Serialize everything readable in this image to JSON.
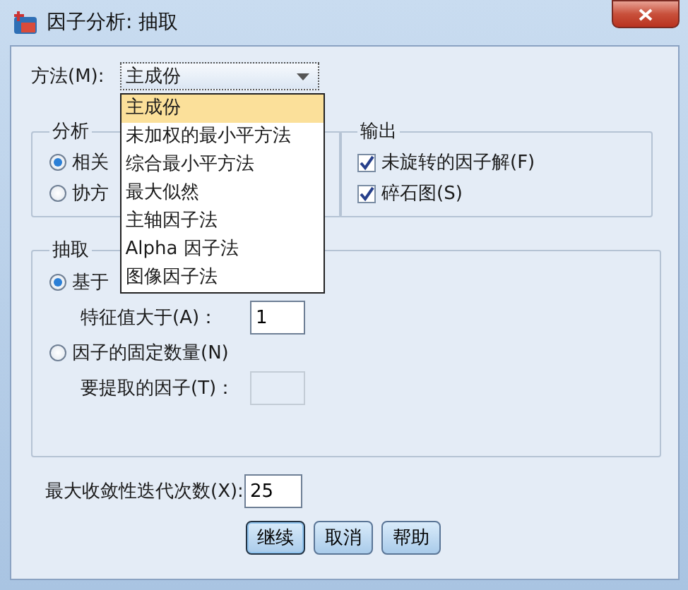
{
  "window": {
    "title": "因子分析: 抽取"
  },
  "method": {
    "label": "方法(M):",
    "value": "主成份",
    "expanded": true,
    "options": [
      {
        "label": "主成份",
        "selected": true
      },
      {
        "label": "未加权的最小平方法",
        "selected": false
      },
      {
        "label": "综合最小平方法",
        "selected": false
      },
      {
        "label": "最大似然",
        "selected": false
      },
      {
        "label": "主轴因子法",
        "selected": false
      },
      {
        "label": "Alpha 因子法",
        "selected": false
      },
      {
        "label": "图像因子法",
        "selected": false
      }
    ]
  },
  "analysis": {
    "title": "分析",
    "options": [
      {
        "label": "相关",
        "selected": true
      },
      {
        "label": "协方",
        "selected": false
      }
    ]
  },
  "output": {
    "title": "输出",
    "options": [
      {
        "label": "未旋转的因子解(F)",
        "checked": true
      },
      {
        "label": "碎石图(S)",
        "checked": true
      }
    ]
  },
  "extract": {
    "title": "抽取",
    "options": [
      {
        "label": "基于",
        "selected": true,
        "field": {
          "label": "特征值大于(A)：",
          "value": "1",
          "disabled": false
        }
      },
      {
        "label": "因子的固定数量(N)",
        "selected": false,
        "field": {
          "label": "要提取的因子(T)：",
          "disabled": true
        }
      }
    ]
  },
  "iterations": {
    "label": "最大收敛性迭代次数(X):",
    "value": "25"
  },
  "buttons": [
    {
      "label": "继续",
      "default": true
    },
    {
      "label": "取消",
      "default": false
    },
    {
      "label": "帮助",
      "default": false
    }
  ]
}
